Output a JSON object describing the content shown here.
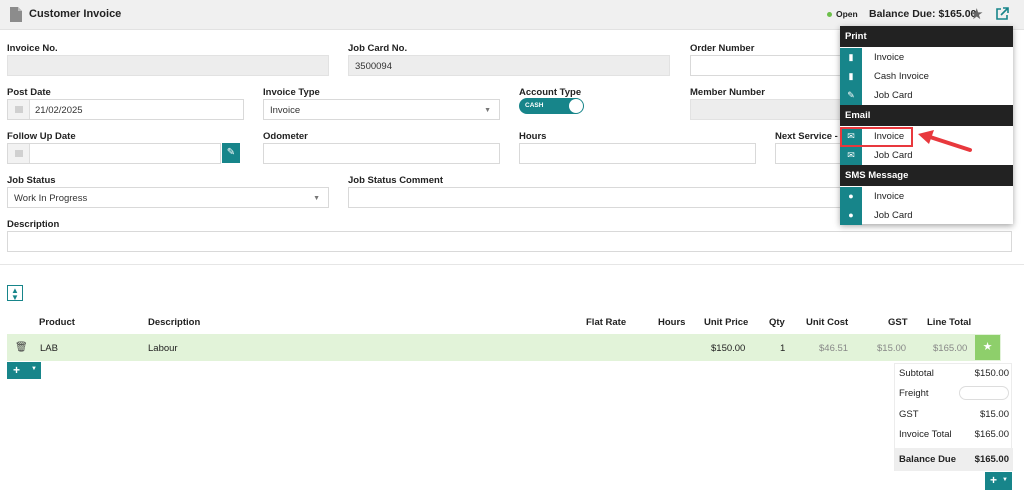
{
  "header": {
    "title": "Customer Invoice",
    "status": "Open",
    "status_color": "#6cbf4a",
    "balance_due": "Balance Due: $165.00"
  },
  "form": {
    "invoice_no": {
      "label": "Invoice No.",
      "value": ""
    },
    "job_card_no": {
      "label": "Job Card No.",
      "value": "3500094"
    },
    "order_number": {
      "label": "Order Number",
      "value": ""
    },
    "post_date": {
      "label": "Post Date",
      "value": "21/02/2025"
    },
    "invoice_type": {
      "label": "Invoice Type",
      "value": "Invoice"
    },
    "account_type": {
      "label": "Account Type",
      "value": "CASH"
    },
    "member_number": {
      "label": "Member Number",
      "value": ""
    },
    "follow_up_date": {
      "label": "Follow Up Date",
      "value": ""
    },
    "odometer": {
      "label": "Odometer",
      "value": ""
    },
    "hours": {
      "label": "Hours",
      "value": ""
    },
    "next_service": {
      "label": "Next Service -"
    },
    "job_status": {
      "label": "Job Status",
      "value": "Work In Progress"
    },
    "job_status_comment": {
      "label": "Job Status Comment",
      "value": ""
    },
    "description": {
      "label": "Description",
      "value": ""
    }
  },
  "table": {
    "columns": [
      "Product",
      "Description",
      "Flat Rate",
      "Hours",
      "Unit Price",
      "Qty",
      "Unit Cost",
      "GST",
      "Line Total"
    ],
    "rows": [
      {
        "product": "LAB",
        "description": "Labour",
        "flat_rate": "",
        "hours": "",
        "unit_price": "$150.00",
        "qty": "1",
        "unit_cost": "$46.51",
        "gst": "$15.00",
        "line_total": "$165.00"
      }
    ]
  },
  "totals": {
    "subtotal_label": "Subtotal",
    "subtotal": "$150.00",
    "freight_label": "Freight",
    "freight": "",
    "gst_label": "GST",
    "gst": "$15.00",
    "invoice_total_label": "Invoice Total",
    "invoice_total": "$165.00",
    "balance_due_label": "Balance Due",
    "balance_due": "$165.00"
  },
  "menu": {
    "print": {
      "label": "Print",
      "items": [
        "Invoice",
        "Cash Invoice",
        "Job Card"
      ]
    },
    "email": {
      "label": "Email",
      "items": [
        "Invoice",
        "Job Card"
      ]
    },
    "sms": {
      "label": "SMS Message",
      "items": [
        "Invoice",
        "Job Card"
      ]
    }
  },
  "colors": {
    "accent": "#17858a",
    "row_highlight": "#e2f3d9",
    "arrow": "#e8383d"
  }
}
